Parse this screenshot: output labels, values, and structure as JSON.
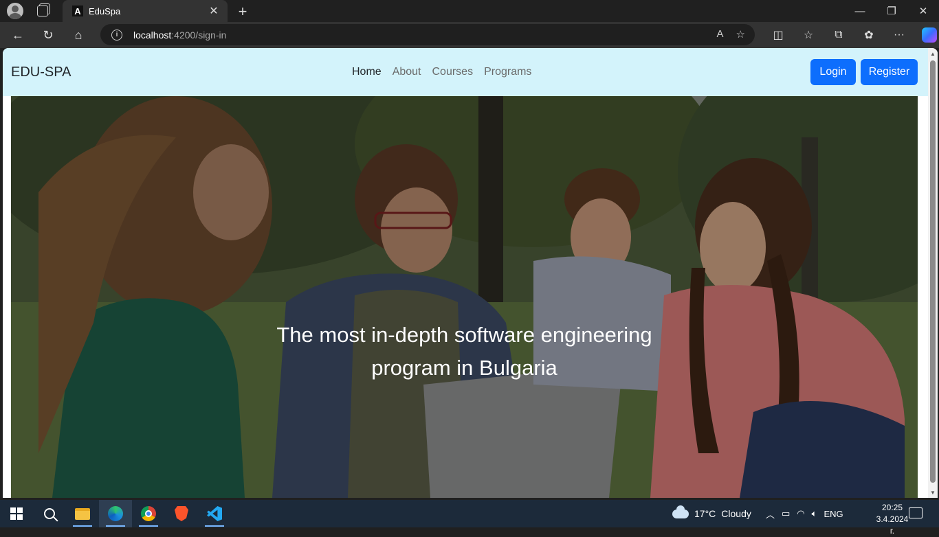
{
  "browser": {
    "tab_title": "EduSpa",
    "tab_favicon": "A",
    "url_host": "localhost",
    "url_rest": ":4200/sign-in",
    "new_tab": "+",
    "close_tab": "✕"
  },
  "app": {
    "brand": "EDU-SPA",
    "nav": [
      {
        "label": "Home",
        "active": true
      },
      {
        "label": "About"
      },
      {
        "label": "Courses"
      },
      {
        "label": "Programs"
      }
    ],
    "login_label": "Login",
    "register_label": "Register",
    "hero_line1": "The most in-depth software engineering",
    "hero_line2": "program in Bulgaria"
  },
  "taskbar": {
    "weather_temp": "17°C",
    "weather_desc": "Cloudy",
    "lang": "ENG",
    "time": "20:25",
    "date": "3.4.2024 г."
  },
  "colors": {
    "header_bg": "#d3f3fb",
    "button_primary": "#0d6efd"
  }
}
